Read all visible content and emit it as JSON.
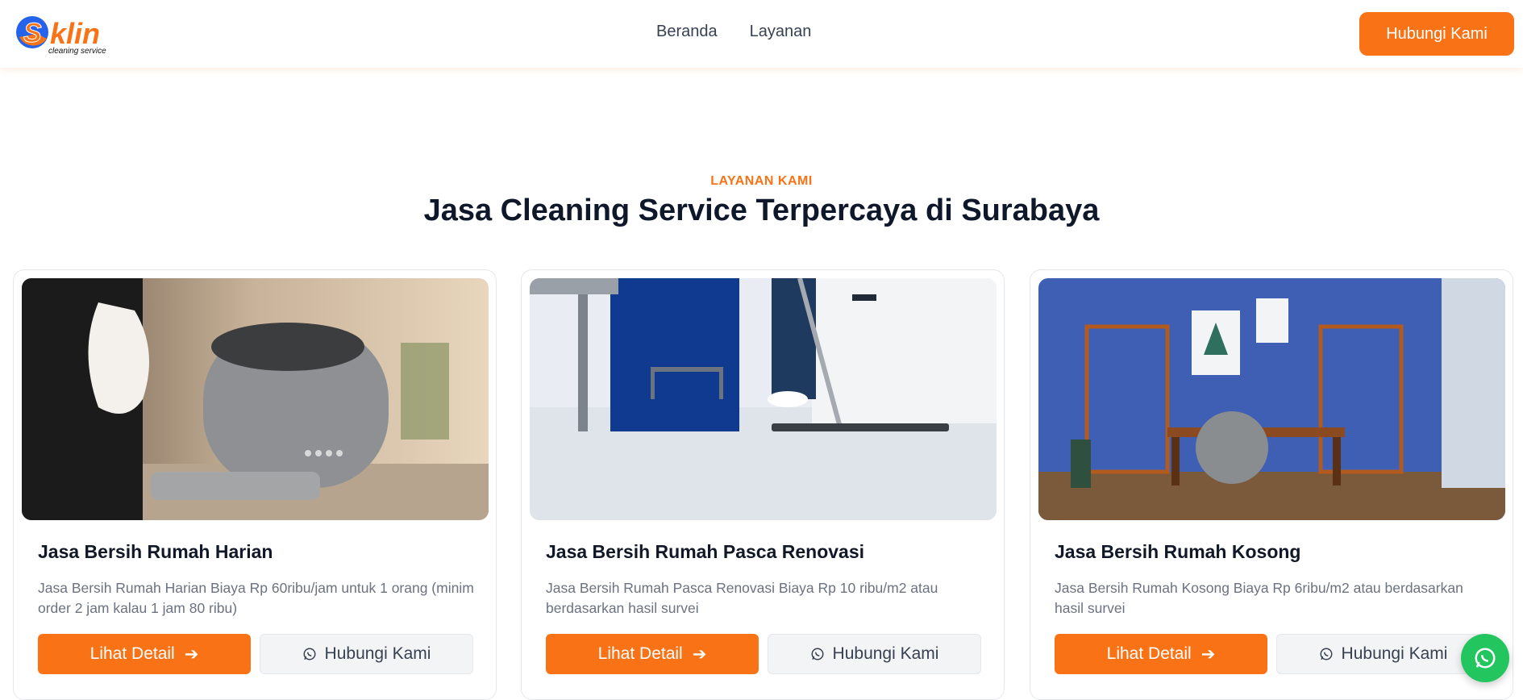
{
  "brand": {
    "name": "klin",
    "tagline": "cleaning service",
    "letter": "S",
    "primary_color": "#f97316",
    "secondary_color": "#2563eb"
  },
  "nav": {
    "links": [
      "Beranda",
      "Layanan"
    ],
    "cta": "Hubungi Kami"
  },
  "section": {
    "eyebrow": "LAYANAN KAMI",
    "title": "Jasa Cleaning Service Terpercaya di Surabaya"
  },
  "cards": [
    {
      "image": "home-cleaning-robot-photo",
      "title": "Jasa Bersih Rumah Harian",
      "description": "Jasa Bersih Rumah Harian Biaya Rp 60ribu/jam untuk 1 orang (minim order 2 jam kalau 1 jam 80 ribu)",
      "detail_label": "Lihat Detail",
      "contact_label": "Hubungi Kami"
    },
    {
      "image": "floor-mopping-photo",
      "title": "Jasa Bersih Rumah Pasca Renovasi",
      "description": "Jasa Bersih Rumah Pasca Renovasi Biaya Rp 10 ribu/m2 atau berdasarkan hasil survei",
      "detail_label": "Lihat Detail",
      "contact_label": "Hubungi Kami"
    },
    {
      "image": "empty-office-room-photo",
      "title": "Jasa Bersih Rumah Kosong",
      "description": "Jasa Bersih Rumah Kosong Biaya Rp 6ribu/m2 atau berdasarkan hasil survei",
      "detail_label": "Lihat Detail",
      "contact_label": "Hubungi Kami"
    }
  ],
  "floating": {
    "icon": "whatsapp-icon",
    "color": "#22c55e"
  }
}
